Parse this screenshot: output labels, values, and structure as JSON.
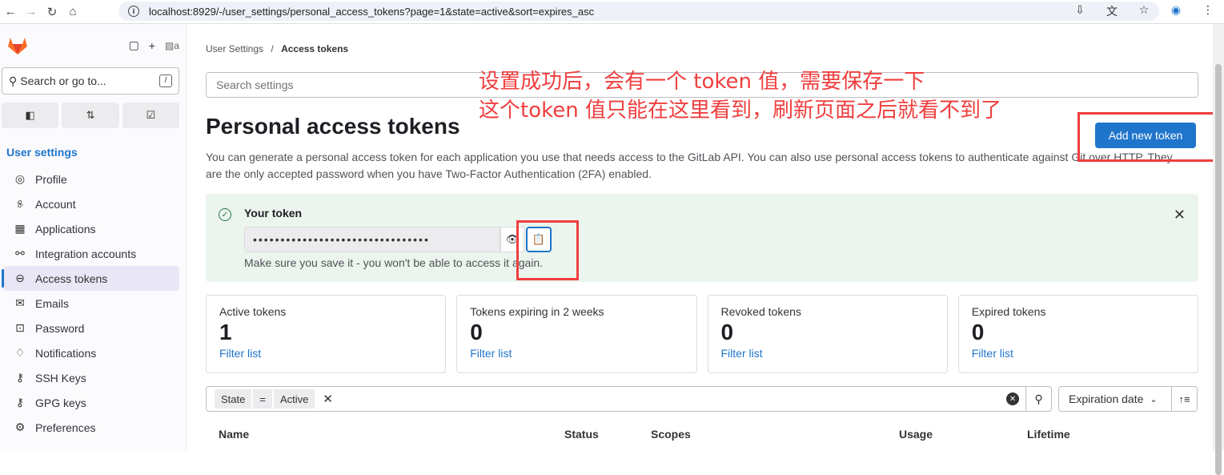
{
  "browser": {
    "url": "localhost:8929/-/user_settings/personal_access_tokens?page=1&state=active&sort=expires_asc"
  },
  "sidebar": {
    "search_label": "Search or go to...",
    "kbd": "/",
    "section_title": "User settings",
    "items": [
      {
        "label": "Profile",
        "icon": "profile-icon"
      },
      {
        "label": "Account",
        "icon": "account-icon"
      },
      {
        "label": "Applications",
        "icon": "applications-icon"
      },
      {
        "label": "Integration accounts",
        "icon": "integration-icon"
      },
      {
        "label": "Access tokens",
        "icon": "token-icon",
        "active": true
      },
      {
        "label": "Emails",
        "icon": "mail-icon"
      },
      {
        "label": "Password",
        "icon": "lock-icon"
      },
      {
        "label": "Notifications",
        "icon": "bell-icon"
      },
      {
        "label": "SSH Keys",
        "icon": "key-icon"
      },
      {
        "label": "GPG keys",
        "icon": "key-icon"
      },
      {
        "label": "Preferences",
        "icon": "preferences-icon"
      }
    ]
  },
  "breadcrumb": {
    "parent": "User Settings",
    "separator": "/",
    "current": "Access tokens"
  },
  "search_settings_placeholder": "Search settings",
  "page_title": "Personal access tokens",
  "description": "You can generate a personal access token for each application you use that needs access to the GitLab API. You can also use personal access tokens to authenticate against Git over HTTP. They are the only accepted password when you have Two-Factor Authentication (2FA) enabled.",
  "add_button": "Add new token",
  "token_alert": {
    "title": "Your token",
    "masked_value": "••••••••••••••••••••••••••••••••",
    "note": "Make sure you save it - you won't be able to access it again."
  },
  "stats": [
    {
      "label": "Active tokens",
      "value": "1",
      "link": "Filter list"
    },
    {
      "label": "Tokens expiring in 2 weeks",
      "value": "0",
      "link": "Filter list"
    },
    {
      "label": "Revoked tokens",
      "value": "0",
      "link": "Filter list"
    },
    {
      "label": "Expired tokens",
      "value": "0",
      "link": "Filter list"
    }
  ],
  "filter": {
    "token_key": "State",
    "token_op": "=",
    "token_value": "Active",
    "sort_label": "Expiration date"
  },
  "table_headers": [
    "Name",
    "Status",
    "Scopes",
    "Usage",
    "Lifetime"
  ],
  "annotation": {
    "line1": "设置成功后，会有一个 token 值，需要保存一下",
    "line2": "这个token 值只能在这里看到，刷新页面之后就看不到了"
  },
  "colors": {
    "accent": "#1f75cb",
    "annotation": "#f03e3e",
    "success_bg": "#ecf4ee"
  }
}
